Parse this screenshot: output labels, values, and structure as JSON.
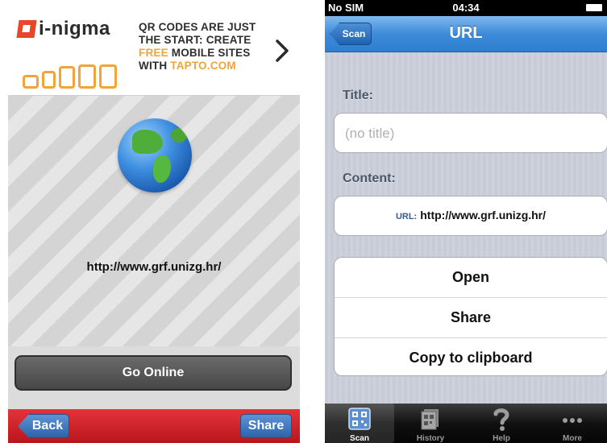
{
  "left_screen": {
    "banner": {
      "logo_text": "i-nigma",
      "promo_line1": "QR CODES ARE JUST",
      "promo_line2": "THE START: CREATE",
      "promo_free": "FREE",
      "promo_line3_rest": " MOBILE SITES",
      "promo_with": "WITH ",
      "promo_brand": "TAPTO.COM"
    },
    "scanned_url": "http://www.grf.unizg.hr/",
    "go_online_label": "Go Online",
    "back_label": "Back",
    "share_label": "Share"
  },
  "right_screen": {
    "status_bar": {
      "carrier": "No SIM",
      "time": "04:34"
    },
    "nav": {
      "back_label": "Scan",
      "title": "URL"
    },
    "title_label": "Title:",
    "title_placeholder": "(no title)",
    "content_label": "Content:",
    "content_key": "URL:",
    "content_value": "http://www.grf.unizg.hr/",
    "actions": [
      "Open",
      "Share",
      "Copy to clipboard"
    ],
    "tabs": [
      {
        "label": "Scan",
        "icon": "qr-scan-icon",
        "selected": true
      },
      {
        "label": "History",
        "icon": "history-icon",
        "selected": false
      },
      {
        "label": "Help",
        "icon": "help-icon",
        "selected": false
      },
      {
        "label": "More",
        "icon": "more-icon",
        "selected": false
      }
    ]
  },
  "colors": {
    "accent_orange": "#f2a33a",
    "logo_red": "#e8452b",
    "toolbar_red": "#d42a30",
    "ios_blue": "#3d8bd9"
  }
}
